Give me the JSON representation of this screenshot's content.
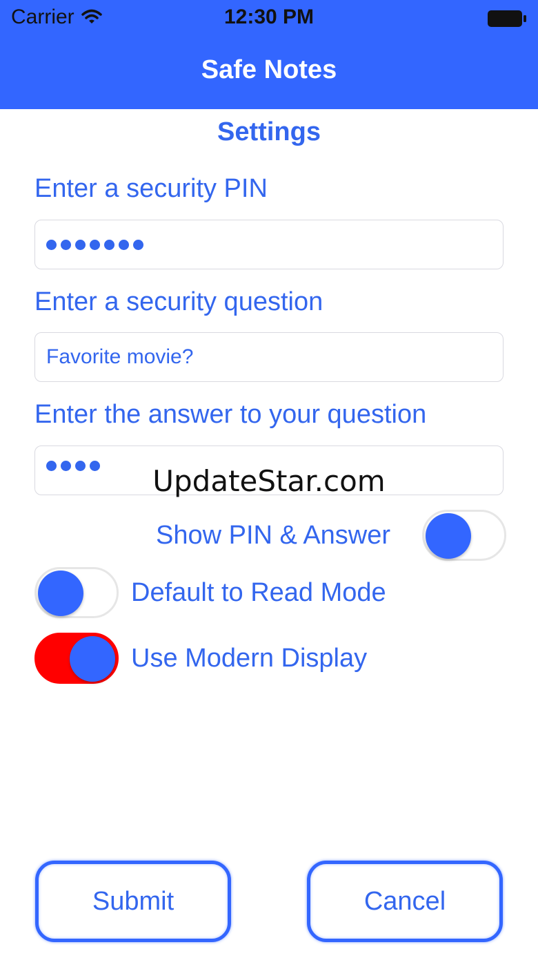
{
  "status_bar": {
    "carrier": "Carrier",
    "time": "12:30 PM"
  },
  "nav": {
    "title": "Safe Notes"
  },
  "settings": {
    "title": "Settings",
    "pin_label": "Enter a security PIN",
    "pin_length": 7,
    "question_label": "Enter a security question",
    "question_value": "Favorite movie?",
    "answer_label": "Enter the answer to your question",
    "answer_length": 4
  },
  "toggles": {
    "show_pin": {
      "label": "Show PIN & Answer",
      "on": false
    },
    "read_mode": {
      "label": "Default to Read Mode",
      "on": false
    },
    "modern_display": {
      "label": "Use Modern Display",
      "on": true
    }
  },
  "buttons": {
    "submit": "Submit",
    "cancel": "Cancel"
  },
  "watermark": "UpdateStar.com",
  "colors": {
    "accent": "#3366ff",
    "text": "#3366ee",
    "switch_on": "#ff0000",
    "icons": [
      "wifi-icon",
      "battery-icon"
    ]
  }
}
